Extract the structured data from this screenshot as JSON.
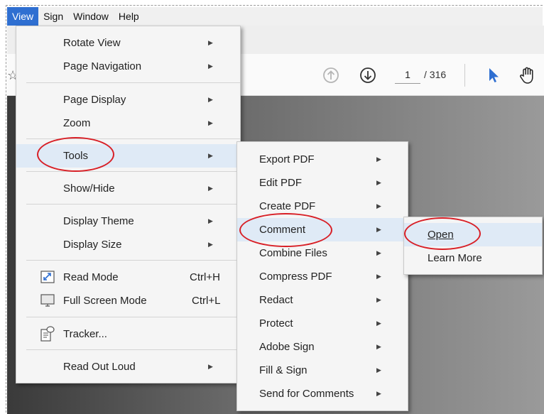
{
  "menubar": {
    "items": [
      "View",
      "Sign",
      "Window",
      "Help"
    ],
    "active": "View"
  },
  "toolbar": {
    "current_page": "1",
    "total_pages": "/ 316"
  },
  "view_menu": {
    "rotate_view": "Rotate View",
    "page_navigation": "Page Navigation",
    "page_display": "Page Display",
    "zoom": "Zoom",
    "tools": "Tools",
    "show_hide": "Show/Hide",
    "display_theme": "Display Theme",
    "display_size": "Display Size",
    "read_mode": "Read Mode",
    "read_mode_shortcut": "Ctrl+H",
    "full_screen_mode": "Full Screen Mode",
    "full_screen_shortcut": "Ctrl+L",
    "tracker": "Tracker...",
    "read_out_loud": "Read Out Loud"
  },
  "tools_menu": {
    "items": [
      "Export PDF",
      "Edit PDF",
      "Create PDF",
      "Comment",
      "Combine Files",
      "Compress PDF",
      "Redact",
      "Protect",
      "Adobe Sign",
      "Fill & Sign",
      "Send for Comments"
    ]
  },
  "comment_menu": {
    "open": "Open",
    "learn_more": "Learn More"
  },
  "colors": {
    "accent": "#2f6fd1",
    "highlight": "#dfeaf6",
    "annotation": "#d81f26"
  }
}
